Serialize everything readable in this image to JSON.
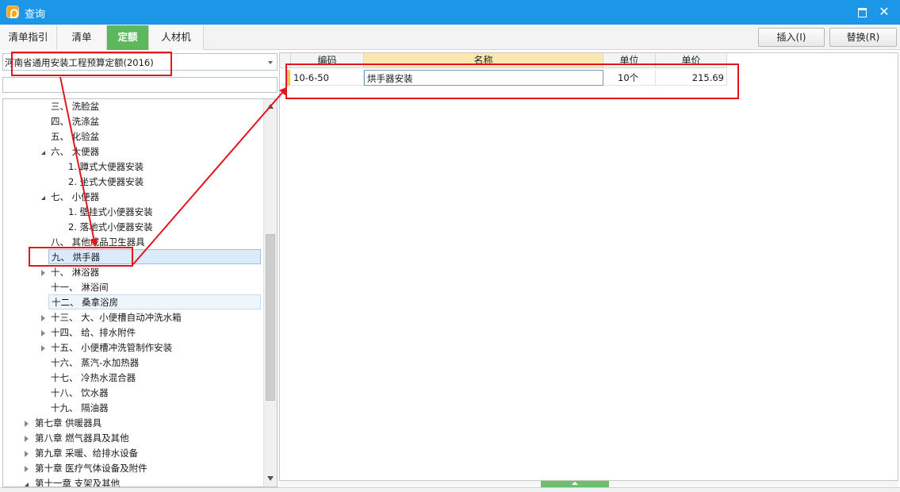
{
  "window": {
    "title": "查询"
  },
  "tabs": [
    {
      "label": "清单指引",
      "active": false
    },
    {
      "label": "清单",
      "active": false
    },
    {
      "label": "定额",
      "active": true
    },
    {
      "label": "人材机",
      "active": false
    }
  ],
  "actions": {
    "insert_label": "插入(I)",
    "replace_label": "替换(R)"
  },
  "left": {
    "quota_library": "河南省通用安装工程预算定额(2016)",
    "search_value": "",
    "tree": [
      {
        "label": "三、 洗脸盆",
        "level": 3,
        "expander": "none"
      },
      {
        "label": "四、 洗涤盆",
        "level": 3,
        "expander": "none"
      },
      {
        "label": "五、 化验盆",
        "level": 3,
        "expander": "none"
      },
      {
        "label": "六、 大便器",
        "level": 3,
        "expander": "open"
      },
      {
        "label": "1. 蹲式大便器安装",
        "level": 4,
        "expander": "none"
      },
      {
        "label": "2. 坐式大便器安装",
        "level": 4,
        "expander": "none"
      },
      {
        "label": "七、 小便器",
        "level": 3,
        "expander": "open"
      },
      {
        "label": "1. 壁挂式小便器安装",
        "level": 4,
        "expander": "none"
      },
      {
        "label": "2. 落地式小便器安装",
        "level": 4,
        "expander": "none"
      },
      {
        "label": "八、 其他成品卫生器具",
        "level": 3,
        "expander": "none"
      },
      {
        "label": "九、 烘手器",
        "level": 3,
        "expander": "none",
        "selected": true
      },
      {
        "label": "十、 淋浴器",
        "level": 3,
        "expander": "closed"
      },
      {
        "label": "十一、 淋浴间",
        "level": 3,
        "expander": "none"
      },
      {
        "label": "十二、 桑拿浴房",
        "level": 3,
        "expander": "none",
        "hover": true
      },
      {
        "label": "十三、 大、小便槽自动冲洗水箱",
        "level": 3,
        "expander": "closed"
      },
      {
        "label": "十四、 给、排水附件",
        "level": 3,
        "expander": "closed"
      },
      {
        "label": "十五、 小便槽冲洗管制作安装",
        "level": 3,
        "expander": "closed"
      },
      {
        "label": "十六、 蒸汽-水加热器",
        "level": 3,
        "expander": "none"
      },
      {
        "label": "十七、 冷热水混合器",
        "level": 3,
        "expander": "none"
      },
      {
        "label": "十八、 饮水器",
        "level": 3,
        "expander": "none"
      },
      {
        "label": "十九、 隔油器",
        "level": 3,
        "expander": "none"
      },
      {
        "label": "第七章 供暖器具",
        "level": 2,
        "expander": "closed"
      },
      {
        "label": "第八章 燃气器具及其他",
        "level": 2,
        "expander": "closed"
      },
      {
        "label": "第九章 采暖、给排水设备",
        "level": 2,
        "expander": "closed"
      },
      {
        "label": "第十章 医疗气体设备及附件",
        "level": 2,
        "expander": "closed"
      },
      {
        "label": "第十一章 支架及其他",
        "level": 2,
        "expander": "open"
      }
    ]
  },
  "grid": {
    "columns": [
      "编码",
      "名称",
      "单位",
      "单价"
    ],
    "rows": [
      {
        "code": "10-6-50",
        "name": "烘手器安装",
        "unit": "10个",
        "price": "215.69"
      }
    ]
  },
  "colors": {
    "title_bar": "#1c97e8",
    "active_tab": "#5cb85c",
    "annotation": "#e3171b"
  }
}
